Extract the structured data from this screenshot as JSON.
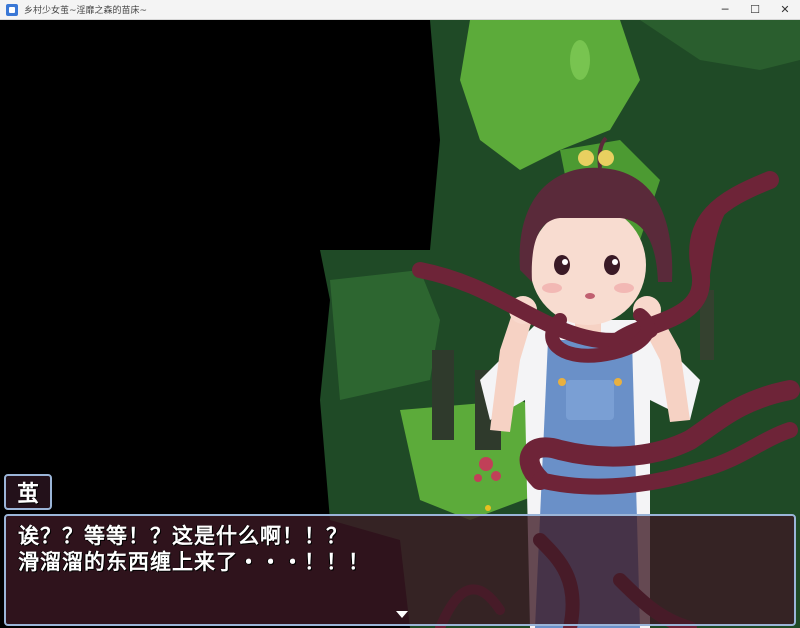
{
  "window": {
    "title": "乡村少女茧~淫靡之森的苗床~",
    "minimize": "─",
    "maximize": "☐",
    "close": "✕",
    "icon": "game-app-icon"
  },
  "dialog": {
    "speaker": "茧",
    "lines": [
      "诶？？等等！？这是什么啊！！？",
      "滑溜溜的东西缠上来了・・・！！！"
    ],
    "continue_icon": "triangle-down-icon"
  },
  "colors": {
    "window_border": "#9bb5d8",
    "message_bg": "#3c1824",
    "tentacle": "#6e2438",
    "forest_grass": "#5cab3a",
    "forest_dark": "#1f4a26"
  }
}
